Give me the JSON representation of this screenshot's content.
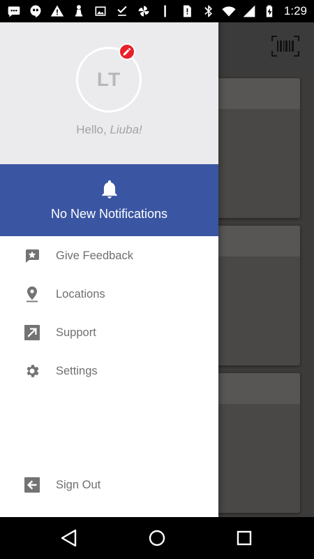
{
  "status_bar": {
    "time": "1:29",
    "left_icons": [
      "messenger-icon",
      "hangouts-icon",
      "warning-icon",
      "pawn-icon",
      "image-icon",
      "download-done-icon",
      "pinwheel-icon",
      "vibrate-icon",
      "sim-icon"
    ],
    "right_icons": [
      "bluetooth-icon",
      "wifi-icon",
      "signal-icon",
      "battery-charging-icon"
    ]
  },
  "app_bar": {
    "action_icon": "barcode-scan-icon"
  },
  "profile": {
    "initials": "LT",
    "greeting_prefix": "Hello,",
    "name": "Liuba!",
    "edit_icon": "pencil-icon",
    "background": "#ebebed"
  },
  "notifications": {
    "text": "No New Notifications",
    "icon": "bell-icon",
    "background": "#3a55a2"
  },
  "menu": {
    "items": [
      {
        "label": "Give Feedback",
        "icon": "feedback-star-icon"
      },
      {
        "label": "Locations",
        "icon": "location-pin-icon"
      },
      {
        "label": "Support",
        "icon": "external-link-icon"
      },
      {
        "label": "Settings",
        "icon": "gear-icon"
      }
    ],
    "sign_out": {
      "label": "Sign Out",
      "icon": "exit-arrow-icon"
    }
  },
  "nav_bar": {
    "buttons": [
      "back-icon",
      "home-icon",
      "recents-icon"
    ]
  }
}
